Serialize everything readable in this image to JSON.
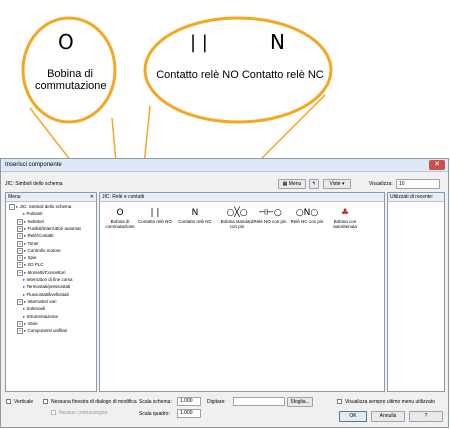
{
  "callouts": {
    "coil": {
      "symbol": "O",
      "label": "Bobina di commutazione"
    },
    "contacts": {
      "symbol_no": "| |",
      "symbol_nc": "N",
      "label": "Contatto relè NO Contatto relè NC"
    }
  },
  "dialog": {
    "title": "Inserisci componente",
    "close": "✕",
    "breadcrumb": "JIC: Simboli dello schema",
    "menu_label": "Menu",
    "view_label": "Viste",
    "zoom_label": "Visualizza:",
    "zoom_value": "10",
    "left_panel_title": "Menu",
    "left_panel_close": "✕",
    "center_panel_title": "JIC: Relè e contatti",
    "right_panel_title": "Utilizzati di recente:",
    "tree": [
      {
        "label": "JIC: Simboli dello schema",
        "level": 0,
        "expander": "-"
      },
      {
        "label": "Pulsanti",
        "level": 1,
        "expander": ""
      },
      {
        "label": "Selettori",
        "level": 1,
        "expander": "+"
      },
      {
        "label": "Fusibili/Interruttori automat",
        "level": 1,
        "expander": "+"
      },
      {
        "label": "Relè/Contatti",
        "level": 1,
        "expander": "+"
      },
      {
        "label": "Timer",
        "level": 1,
        "expander": "+"
      },
      {
        "label": "Controllo motore",
        "level": 1,
        "expander": "+"
      },
      {
        "label": "Spie",
        "level": 1,
        "expander": "+"
      },
      {
        "label": "I/O PLC",
        "level": 1,
        "expander": "+"
      },
      {
        "label": "Morsetti/Connettori",
        "level": 1,
        "expander": "+"
      },
      {
        "label": "Interruttori di fine corsa",
        "level": 1,
        "expander": ""
      },
      {
        "label": "Termostati/pressostati",
        "level": 1,
        "expander": ""
      },
      {
        "label": "Flussostati/livellostati",
        "level": 1,
        "expander": ""
      },
      {
        "label": "Interruttori vari",
        "level": 1,
        "expander": "+"
      },
      {
        "label": "Solenoidi",
        "level": 1,
        "expander": ""
      },
      {
        "label": "Strumentazione",
        "level": 1,
        "expander": ""
      },
      {
        "label": "Varie",
        "level": 1,
        "expander": "+"
      },
      {
        "label": "Componenti unifilari",
        "level": 1,
        "expander": "+"
      }
    ],
    "symbols": [
      {
        "glyph": "O",
        "label": "Bobina di commutazione"
      },
      {
        "glyph": "| |",
        "label": "Contatto relè NO"
      },
      {
        "glyph": "N",
        "label": "Contatto relè NC"
      },
      {
        "glyph": "○╳○",
        "label": "Bobina standard con pin"
      },
      {
        "glyph": "⊣⊢○",
        "label": "Relè NO con pin"
      },
      {
        "glyph": "○N○",
        "label": "Relè NC con pin"
      },
      {
        "glyph": "♣",
        "label": "Bobina con autoritenuta"
      }
    ],
    "bottom": {
      "vertical_label": "Verticale",
      "no_dialog_label": "Nessuna finestra di dialogo di modifica",
      "no_tag_label": "Nessun contrassegno",
      "schema_scale_label": "Scala schema:",
      "schema_scale_value": "1.000",
      "frame_scale_label": "Scala quadro:",
      "frame_scale_value": "1.000",
      "type_label": "Digitare:",
      "type_value": "",
      "browse_label": "Sfoglia...",
      "always_show_label": "Visualizza sempre ultimo menu utilizzato",
      "ok_label": "OK",
      "cancel_label": "Annulla",
      "help_label": "?"
    }
  }
}
